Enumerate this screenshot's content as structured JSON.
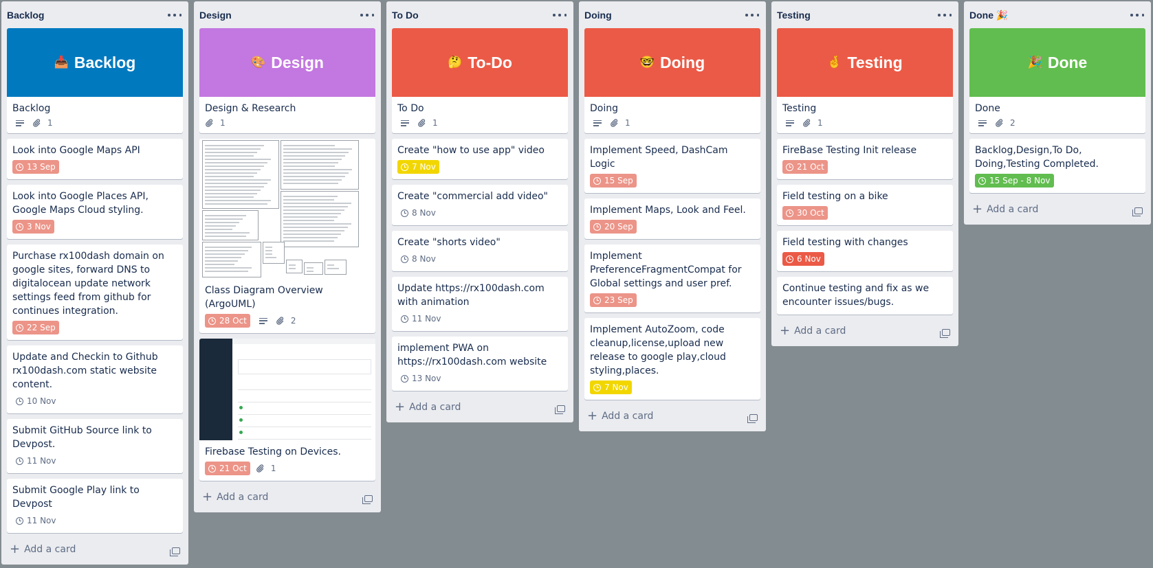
{
  "lists": [
    {
      "title": "Backlog",
      "cover": {
        "emoji": "📥",
        "text": "Backlog",
        "color": "#0079bf"
      },
      "cards": [
        {
          "title": "Backlog",
          "description": true,
          "attachments": "1"
        },
        {
          "title": "Look into Google Maps API",
          "due": "13 Sep",
          "due_state": "overdue"
        },
        {
          "title": "Look into Google Places API, Google Maps Cloud styling.",
          "due": "3 Nov",
          "due_state": "overdue"
        },
        {
          "title": "Purchase rx100dash domain on google sites, forward DNS to digitalocean update network settings feed from github for continues integration.",
          "due": "22 Sep",
          "due_state": "overdue"
        },
        {
          "title": "Update and Checkin to Github rx100dash.com static website content.",
          "due": "10 Nov",
          "due_state": "normal"
        },
        {
          "title": "Submit GitHub Source link to Devpost.",
          "due": "11 Nov",
          "due_state": "normal"
        },
        {
          "title": "Submit Google Play link to Devpost",
          "due": "11 Nov",
          "due_state": "normal"
        }
      ],
      "add_label": "Add a card"
    },
    {
      "title": "Design",
      "cover": {
        "emoji": "🎨",
        "text": "Design",
        "color": "#c377e0"
      },
      "cards": [
        {
          "title": "Design & Research",
          "attachments": "1"
        },
        {
          "title": "Class Diagram Overview (ArgoUML)",
          "due": "28 Oct",
          "due_state": "overdue",
          "description": true,
          "attachments": "2",
          "image": "class-diagram"
        },
        {
          "title": "Firebase Testing on Devices.",
          "due": "21 Oct",
          "due_state": "overdue",
          "attachments": "1",
          "image": "firebase"
        }
      ],
      "add_label": "Add a card"
    },
    {
      "title": "To Do",
      "cover": {
        "emoji": "🤔",
        "text": "To-Do",
        "color": "#eb5a46"
      },
      "cards": [
        {
          "title": "To Do",
          "description": true,
          "attachments": "1"
        },
        {
          "title": "Create \"how to use app\" video",
          "due": "7 Nov",
          "due_state": "due-soon"
        },
        {
          "title": "Create \"commercial add video\"",
          "due": "8 Nov",
          "due_state": "normal"
        },
        {
          "title": "Create \"shorts video\"",
          "due": "8 Nov",
          "due_state": "normal"
        },
        {
          "title": "Update https://rx100dash.com with animation",
          "due": "11 Nov",
          "due_state": "normal"
        },
        {
          "title": "implement PWA on https://rx100dash.com website",
          "due": "13 Nov",
          "due_state": "normal"
        }
      ],
      "add_label": "Add a card"
    },
    {
      "title": "Doing",
      "cover": {
        "emoji": "🤓",
        "text": "Doing",
        "color": "#eb5a46"
      },
      "cards": [
        {
          "title": "Doing",
          "description": true,
          "attachments": "1"
        },
        {
          "title": "Implement Speed, DashCam Logic",
          "due": "15 Sep",
          "due_state": "overdue"
        },
        {
          "title": "Implement Maps, Look and Feel.",
          "due": "20 Sep",
          "due_state": "overdue"
        },
        {
          "title": "Implement PreferenceFragmentCompat for Global settings and user pref.",
          "due": "23 Sep",
          "due_state": "overdue"
        },
        {
          "title": "Implement AutoZoom, code cleanup,license,upload new release to google play,cloud styling,places.",
          "due": "7 Nov",
          "due_state": "due-soon"
        }
      ],
      "add_label": "Add a card"
    },
    {
      "title": "Testing",
      "cover": {
        "emoji": "🤞",
        "text": "Testing",
        "color": "#eb5a46"
      },
      "cards": [
        {
          "title": "Testing",
          "description": true,
          "attachments": "1"
        },
        {
          "title": "FireBase Testing Init release",
          "due": "21 Oct",
          "due_state": "overdue"
        },
        {
          "title": "Field testing on a bike",
          "due": "30 Oct",
          "due_state": "overdue"
        },
        {
          "title": "Field testing with changes",
          "due": "6 Nov",
          "due_state": "overdue-strong"
        },
        {
          "title": "Continue testing and fix as we encounter issues/bugs."
        }
      ],
      "add_label": "Add a card"
    },
    {
      "title": "Done 🎉",
      "cover": {
        "emoji": "🎉",
        "text": "Done",
        "color": "#61bd4f"
      },
      "cards": [
        {
          "title": "Done",
          "description": true,
          "attachments": "2"
        },
        {
          "title": "Backlog,Design,To Do, Doing,Testing Completed.",
          "due": "15 Sep - 8 Nov",
          "due_state": "complete"
        }
      ],
      "add_label": "Add a card"
    }
  ]
}
